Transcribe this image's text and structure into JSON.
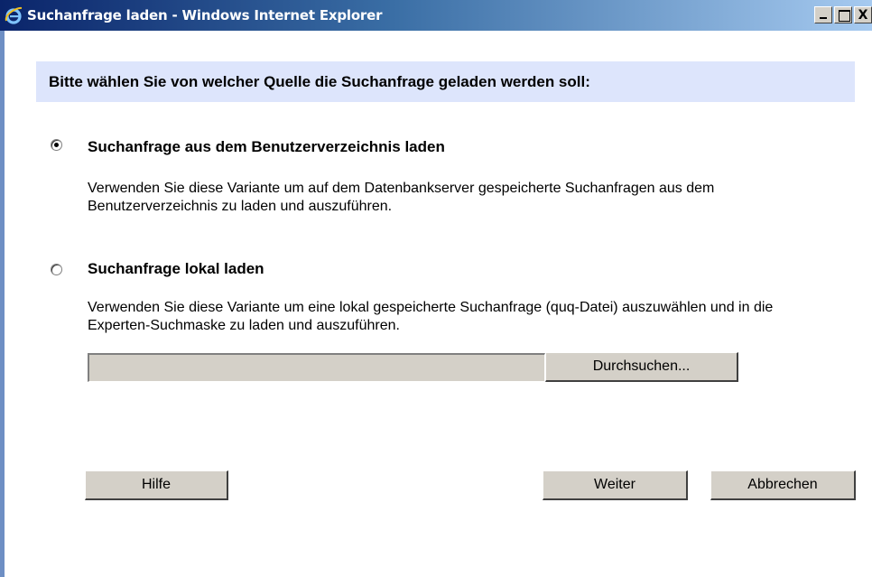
{
  "window": {
    "title": "Suchanfrage laden - Windows Internet Explorer",
    "controls": {
      "minimize": "_",
      "maximize": "□",
      "close": "X"
    }
  },
  "heading": "Bitte wählen Sie von welcher Quelle die Suchanfrage geladen werden soll:",
  "options": [
    {
      "title": "Suchanfrage aus dem Benutzerverzeichnis laden",
      "description": "Verwenden Sie diese Variante um auf dem Datenbankserver gespeicherte Suchanfragen aus dem Benutzerverzeichnis zu laden und auszuführen.",
      "selected": true
    },
    {
      "title": "Suchanfrage lokal laden",
      "description": "Verwenden Sie diese Variante um eine lokal gespeicherte Suchanfrage (quq-Datei) auszuwählen und in die Experten-Suchmaske zu laden und auszuführen.",
      "selected": false
    }
  ],
  "file_input": {
    "value": "",
    "browse_label": "Durchsuchen..."
  },
  "buttons": {
    "help": "Hilfe",
    "next": "Weiter",
    "cancel": "Abbrechen"
  },
  "colors": {
    "heading_bg": "#dde5fc",
    "titlebar_start": "#0a246a",
    "titlebar_end": "#a6caf0",
    "button_face": "#d4d0c8"
  }
}
